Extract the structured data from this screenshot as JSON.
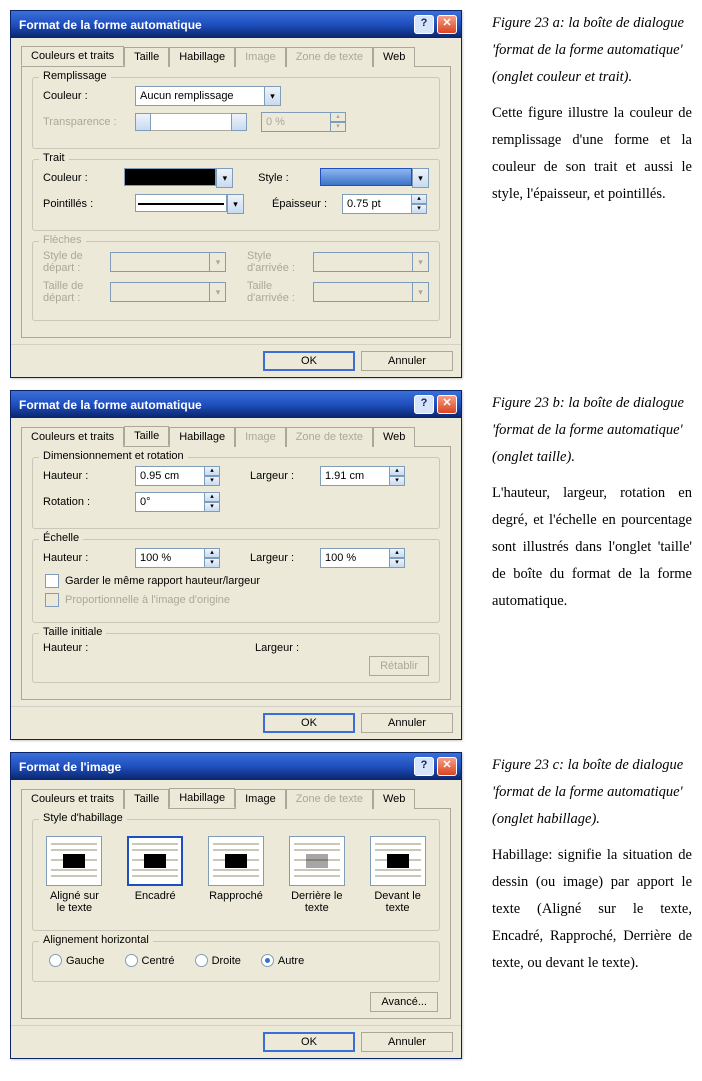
{
  "dialogA": {
    "title": "Format de la forme automatique",
    "tabs": [
      "Couleurs et traits",
      "Taille",
      "Habillage",
      "Image",
      "Zone de texte",
      "Web"
    ],
    "fill": {
      "group": "Remplissage",
      "color_label": "Couleur :",
      "color_value": "Aucun remplissage",
      "transparency_label": "Transparence :",
      "transparency_value": "0 %"
    },
    "line": {
      "group": "Trait",
      "color_label": "Couleur :",
      "style_label": "Style :",
      "dashed_label": "Pointillés :",
      "weight_label": "Épaisseur :",
      "weight_value": "0.75 pt"
    },
    "arrows": {
      "group": "Flèches",
      "begin_style": "Style de départ :",
      "end_style": "Style d'arrivée :",
      "begin_size": "Taille de départ :",
      "end_size": "Taille d'arrivée :"
    },
    "ok": "OK",
    "cancel": "Annuler"
  },
  "dialogB": {
    "title": "Format de la forme automatique",
    "tabs": [
      "Couleurs et traits",
      "Taille",
      "Habillage",
      "Image",
      "Zone de texte",
      "Web"
    ],
    "dim": {
      "group": "Dimensionnement et rotation",
      "height_label": "Hauteur :",
      "height_value": "0.95 cm",
      "width_label": "Largeur :",
      "width_value": "1.91 cm",
      "rotation_label": "Rotation :",
      "rotation_value": "0°"
    },
    "scale": {
      "group": "Échelle",
      "height_label": "Hauteur :",
      "height_value": "100 %",
      "width_label": "Largeur :",
      "width_value": "100 %",
      "lock_label": "Garder le même rapport hauteur/largeur",
      "relative_label": "Proportionnelle à l'image d'origine"
    },
    "orig": {
      "group": "Taille initiale",
      "height_label": "Hauteur :",
      "width_label": "Largeur :",
      "reset": "Rétablir"
    },
    "ok": "OK",
    "cancel": "Annuler"
  },
  "dialogC": {
    "title": "Format de l'image",
    "tabs": [
      "Couleurs et traits",
      "Taille",
      "Habillage",
      "Image",
      "Zone de texte",
      "Web"
    ],
    "wrap": {
      "group": "Style d'habillage",
      "options": [
        "Aligné sur le texte",
        "Encadré",
        "Rapproché",
        "Derrière le texte",
        "Devant le texte"
      ]
    },
    "align": {
      "group": "Alignement horizontal",
      "options": [
        "Gauche",
        "Centré",
        "Droite",
        "Autre"
      ]
    },
    "advanced": "Avancé...",
    "ok": "OK",
    "cancel": "Annuler"
  },
  "captions": {
    "a_title": "Figure 23 a: la boîte de dialogue 'format de la forme automatique' (onglet couleur et trait).",
    "a_desc": "Cette figure illustre la couleur de remplissage d'une forme et la couleur de son trait et aussi le style, l'épaisseur, et pointillés.",
    "b_title": "Figure 23 b: la boîte de dialogue 'format de la forme automatique' (onglet taille).",
    "b_desc": "L'hauteur, largeur, rotation en degré, et l'échelle en pourcentage sont illustrés dans l'onglet 'taille' de boîte du format de la forme automatique.",
    "c_title": "Figure 23 c: la boîte de dialogue 'format de la forme automatique' (onglet habillage).",
    "c_desc": "Habillage: signifie la situation de dessin (ou image) par apport le texte (Aligné sur le texte, Encadré, Rapproché, Derrière de texte, ou devant le texte)."
  }
}
